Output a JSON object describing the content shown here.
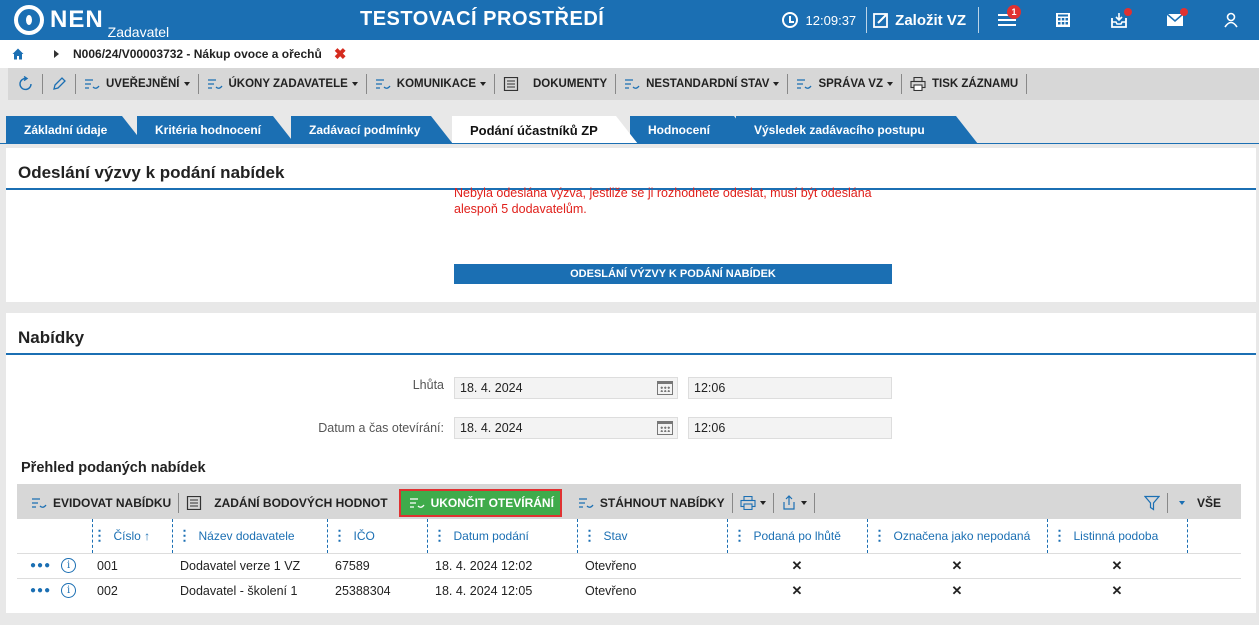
{
  "header": {
    "logo": "NEN",
    "logo_sub": "Zadavatel",
    "environment": "TESTOVACÍ PROSTŘEDÍ",
    "time": "12:09:37",
    "new_vz": "Založit VZ",
    "menu_badge": "1",
    "icons": [
      "clock-icon",
      "edit-icon",
      "menu-icon",
      "calculator-icon",
      "inbox-icon",
      "mail-icon",
      "user-icon"
    ]
  },
  "breadcrumb": {
    "title": "N006/24/V00003732 - Nákup ovoce a ořechů",
    "close": "✖"
  },
  "toolbar": {
    "items": [
      {
        "label": "UVEŘEJNĚNÍ"
      },
      {
        "label": "ÚKONY ZADAVATELE"
      },
      {
        "label": "KOMUNIKACE"
      },
      {
        "label": "DOKUMENTY"
      },
      {
        "label": "NESTANDARDNÍ STAV"
      },
      {
        "label": "SPRÁVA VZ"
      },
      {
        "label": "TISK ZÁZNAMU"
      }
    ]
  },
  "tabs": [
    {
      "label": "Základní údaje"
    },
    {
      "label": "Kritéria hodnocení"
    },
    {
      "label": "Zadávací podmínky"
    },
    {
      "label": "Podání účastníků ZP"
    },
    {
      "label": "Hodnocení"
    },
    {
      "label": "Výsledek zadávacího postupu"
    }
  ],
  "invite_panel": {
    "title": "Odeslání výzvy k podání nabídek",
    "warning": "Nebyla odeslána výzva, jestliže se ji rozhodnete odeslat, musí být odeslána alespoň 5 dodavatelům.",
    "button": "ODESLÁNÍ VÝZVY K PODÁNÍ NABÍDEK"
  },
  "offers_panel": {
    "title": "Nabídky",
    "deadline_label": "Lhůta",
    "deadline_date": "18. 4. 2024",
    "deadline_time": "12:06",
    "opening_label": "Datum a čas otevírání:",
    "opening_date": "18. 4. 2024",
    "opening_time": "12:06",
    "subheading": "Přehled podaných nabídek",
    "grid_toolbar": {
      "evidovat": "EVIDOVAT NABÍDKU",
      "zadani": "ZADÁNÍ BODOVÝCH HODNOT",
      "ukoncit": "UKONČIT OTEVÍRÁNÍ",
      "stahnout": "STÁHNOUT NABÍDKY",
      "all": "VŠE"
    },
    "columns": [
      "Číslo ↑",
      "Název dodavatele",
      "IČO",
      "Datum podání",
      "Stav",
      "Podaná po lhůtě",
      "Označena jako nepodaná",
      "Listinná podoba"
    ],
    "rows": [
      {
        "cislo": "001",
        "nazev": "Dodavatel verze 1 VZ",
        "ico": "67589",
        "datum": "18. 4. 2024 12:02",
        "stav": "Otevřeno",
        "po_lhute": "✕",
        "nepodana": "✕",
        "listinna": "✕"
      },
      {
        "cislo": "002",
        "nazev": "Dodavatel - školení 1",
        "ico": "25388304",
        "datum": "18. 4. 2024 12:05",
        "stav": "Otevřeno",
        "po_lhute": "✕",
        "nepodana": "✕",
        "listinna": "✕"
      }
    ]
  },
  "colors": {
    "brand": "#1b6fb3",
    "danger": "#e0201b",
    "success": "#3fab4b"
  }
}
